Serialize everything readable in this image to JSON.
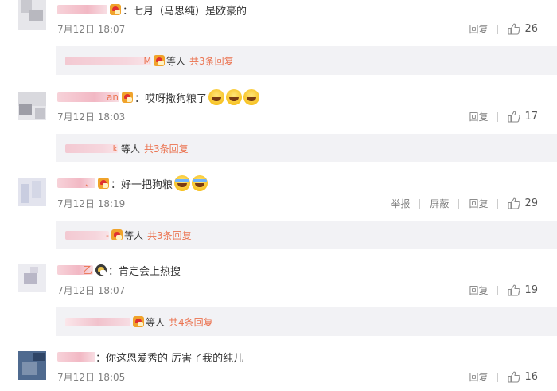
{
  "comments": [
    {
      "name_tail": "",
      "text": "：七月（马思纯）是欧豪的",
      "time": "7月12日 18:07",
      "actions": [
        "回复"
      ],
      "likes": "26",
      "reply": {
        "name_tail": "M",
        "others": "等人",
        "link": "共3条回复"
      }
    },
    {
      "name_tail": "an",
      "text": "：哎呀撒狗粮了",
      "time": "7月12日 18:03",
      "actions": [
        "回复"
      ],
      "likes": "17",
      "reply": {
        "name_tail": "k",
        "others": "等人",
        "link": "共3条回复"
      }
    },
    {
      "name_tail": "、",
      "text": "：好一把狗粮",
      "time": "7月12日 18:19",
      "actions": [
        "举报",
        "屏蔽",
        "回复"
      ],
      "likes": "29",
      "reply": {
        "name_tail": "-",
        "others": "等人",
        "link": "共3条回复"
      }
    },
    {
      "name_tail": "乙",
      "text": "：肯定会上热搜",
      "time": "7月12日 18:07",
      "actions": [
        "回复"
      ],
      "likes": "19",
      "reply": {
        "name_tail": "",
        "others": "等人",
        "link": "共4条回复"
      }
    },
    {
      "name_tail": "",
      "text": "：你这恩爱秀的 厉害了我的纯儿",
      "time": "7月12日 18:05",
      "actions": [
        "回复"
      ],
      "likes": "16"
    }
  ],
  "icons": {
    "like": "thumbs-up-icon",
    "vip_badge": "vip-crown-icon",
    "emoji_grin": "grin-emoji-icon",
    "emoji_laugh_cry": "laugh-cry-emoji-icon"
  },
  "colors": {
    "link": "#eb7350",
    "meta": "#808080",
    "reply_bg": "#f2f2f5"
  }
}
